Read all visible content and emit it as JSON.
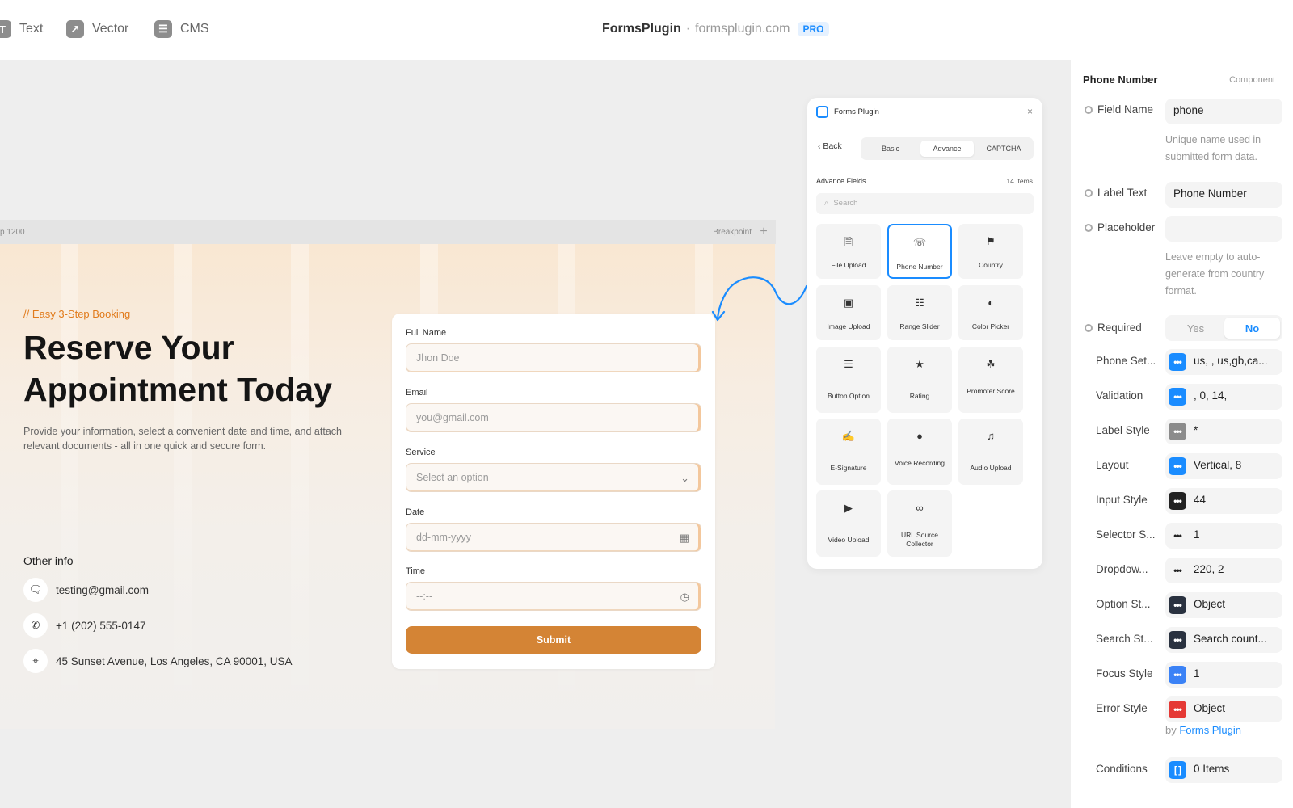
{
  "toolbar": {
    "tools": [
      {
        "label": "Text",
        "icon": "text-icon",
        "glyph": "T"
      },
      {
        "label": "Vector",
        "icon": "vector-icon",
        "glyph": "↗"
      },
      {
        "label": "CMS",
        "icon": "cms-icon",
        "glyph": "☰"
      }
    ],
    "brand_name": "FormsPlugin",
    "separator": "·",
    "brand_domain": "formsplugin.com",
    "badge": "PRO"
  },
  "canvas": {
    "breakpoint_left": "p 1200",
    "breakpoint_right": "Breakpoint",
    "tagline": "// Easy 3-Step Booking",
    "hero_title": "Reserve Your Appointment Today",
    "description": "Provide your information, select a convenient date and time, and attach relevant documents - all in one quick and secure form.",
    "other_info_title": "Other info",
    "contacts": [
      {
        "icon": "chat-icon",
        "text": "testing@gmail.com"
      },
      {
        "icon": "phone-icon",
        "text": "+1 (202) 555-0147"
      },
      {
        "icon": "location-icon",
        "text": "45 Sunset Avenue, Los Angeles, CA 90001, USA"
      }
    ],
    "form": {
      "fields": [
        {
          "label": "Full Name",
          "placeholder": "Jhon Doe"
        },
        {
          "label": "Email",
          "placeholder": "you@gmail.com"
        },
        {
          "label": "Service",
          "placeholder": "Select an option",
          "icon": "chevron-down-icon"
        },
        {
          "label": "Date",
          "placeholder": "dd-mm-yyyy",
          "icon": "calendar-icon"
        },
        {
          "label": "Time",
          "placeholder": "--:--",
          "icon": "clock-icon"
        }
      ],
      "submit_label": "Submit"
    }
  },
  "plugin": {
    "title": "Forms Plugin",
    "close": "×",
    "back_label": "‹  Back",
    "tabs": [
      "Basic",
      "Advance",
      "CAPTCHA"
    ],
    "active_tab": "Advance",
    "section_title": "Advance Fields",
    "count": "14 Items",
    "search_placeholder": "Search",
    "items": [
      {
        "label": "File Upload",
        "icon": "file-upload-icon",
        "glyph": "🗎"
      },
      {
        "label": "Phone Number",
        "icon": "phone-icon",
        "glyph": "☏",
        "selected": true
      },
      {
        "label": "Country",
        "icon": "country-icon",
        "glyph": "⚑"
      },
      {
        "label": "Image Upload",
        "icon": "image-upload-icon",
        "glyph": "▣"
      },
      {
        "label": "Range Slider",
        "icon": "range-slider-icon",
        "glyph": "☷"
      },
      {
        "label": "Color Picker",
        "icon": "color-picker-icon",
        "glyph": "◐"
      },
      {
        "label": "Button Option",
        "icon": "button-option-icon",
        "glyph": "☰"
      },
      {
        "label": "Rating",
        "icon": "star-icon",
        "glyph": "★"
      },
      {
        "label": "Promoter Score",
        "icon": "promoter-score-icon",
        "glyph": "☘"
      },
      {
        "label": "E-Signature",
        "icon": "signature-icon",
        "glyph": "✍"
      },
      {
        "label": "Voice Recording",
        "icon": "microphone-icon",
        "glyph": "●"
      },
      {
        "label": "Audio Upload",
        "icon": "audio-upload-icon",
        "glyph": "♫"
      },
      {
        "label": "Video Upload",
        "icon": "video-upload-icon",
        "glyph": "▶"
      },
      {
        "label": "URL Source Collector",
        "icon": "link-icon",
        "glyph": "∞"
      }
    ]
  },
  "properties": {
    "title": "Phone Number",
    "subtitle": "Component",
    "field_name_label": "Field Name",
    "field_name_value": "phone",
    "field_name_hint": "Unique name used in submitted form data.",
    "label_text_label": "Label Text",
    "label_text_value": "Phone Number",
    "placeholder_label": "Placeholder",
    "placeholder_value": "",
    "placeholder_hint": "Leave empty to auto-generate from country format.",
    "required_label": "Required",
    "required_options": [
      "Yes",
      "No"
    ],
    "required_value": "No",
    "objects": [
      {
        "label": "Phone Set...",
        "value": "us, , us,gb,ca...",
        "color": "#1a8cff"
      },
      {
        "label": "Validation",
        "value": ", 0, 14,",
        "color": "#1a8cff"
      },
      {
        "label": "Label Style",
        "value": "*",
        "color": "#8c8c8c"
      },
      {
        "label": "Layout",
        "value": "Vertical, 8",
        "color": "#1a8cff"
      },
      {
        "label": "Input Style",
        "value": "44",
        "color": "#222222"
      },
      {
        "label": "Selector S...",
        "value": "1",
        "color": "#f4f4f4"
      },
      {
        "label": "Dropdow...",
        "value": "220, 2",
        "color": "#f4f4f4"
      },
      {
        "label": "Option St...",
        "value": "Object",
        "color": "#2a3240"
      },
      {
        "label": "Search St...",
        "value": "Search count...",
        "color": "#2a3240"
      },
      {
        "label": "Focus Style",
        "value": "1",
        "color": "#3b82f6"
      },
      {
        "label": "Error Style",
        "value": "Object",
        "color": "#e53935"
      }
    ],
    "by_prefix": "by",
    "by_link": "Forms Plugin",
    "conditions_label": "Conditions",
    "conditions_value": "0 Items",
    "conditions_glyph": "[ ]",
    "conditions_color": "#1a8cff"
  }
}
